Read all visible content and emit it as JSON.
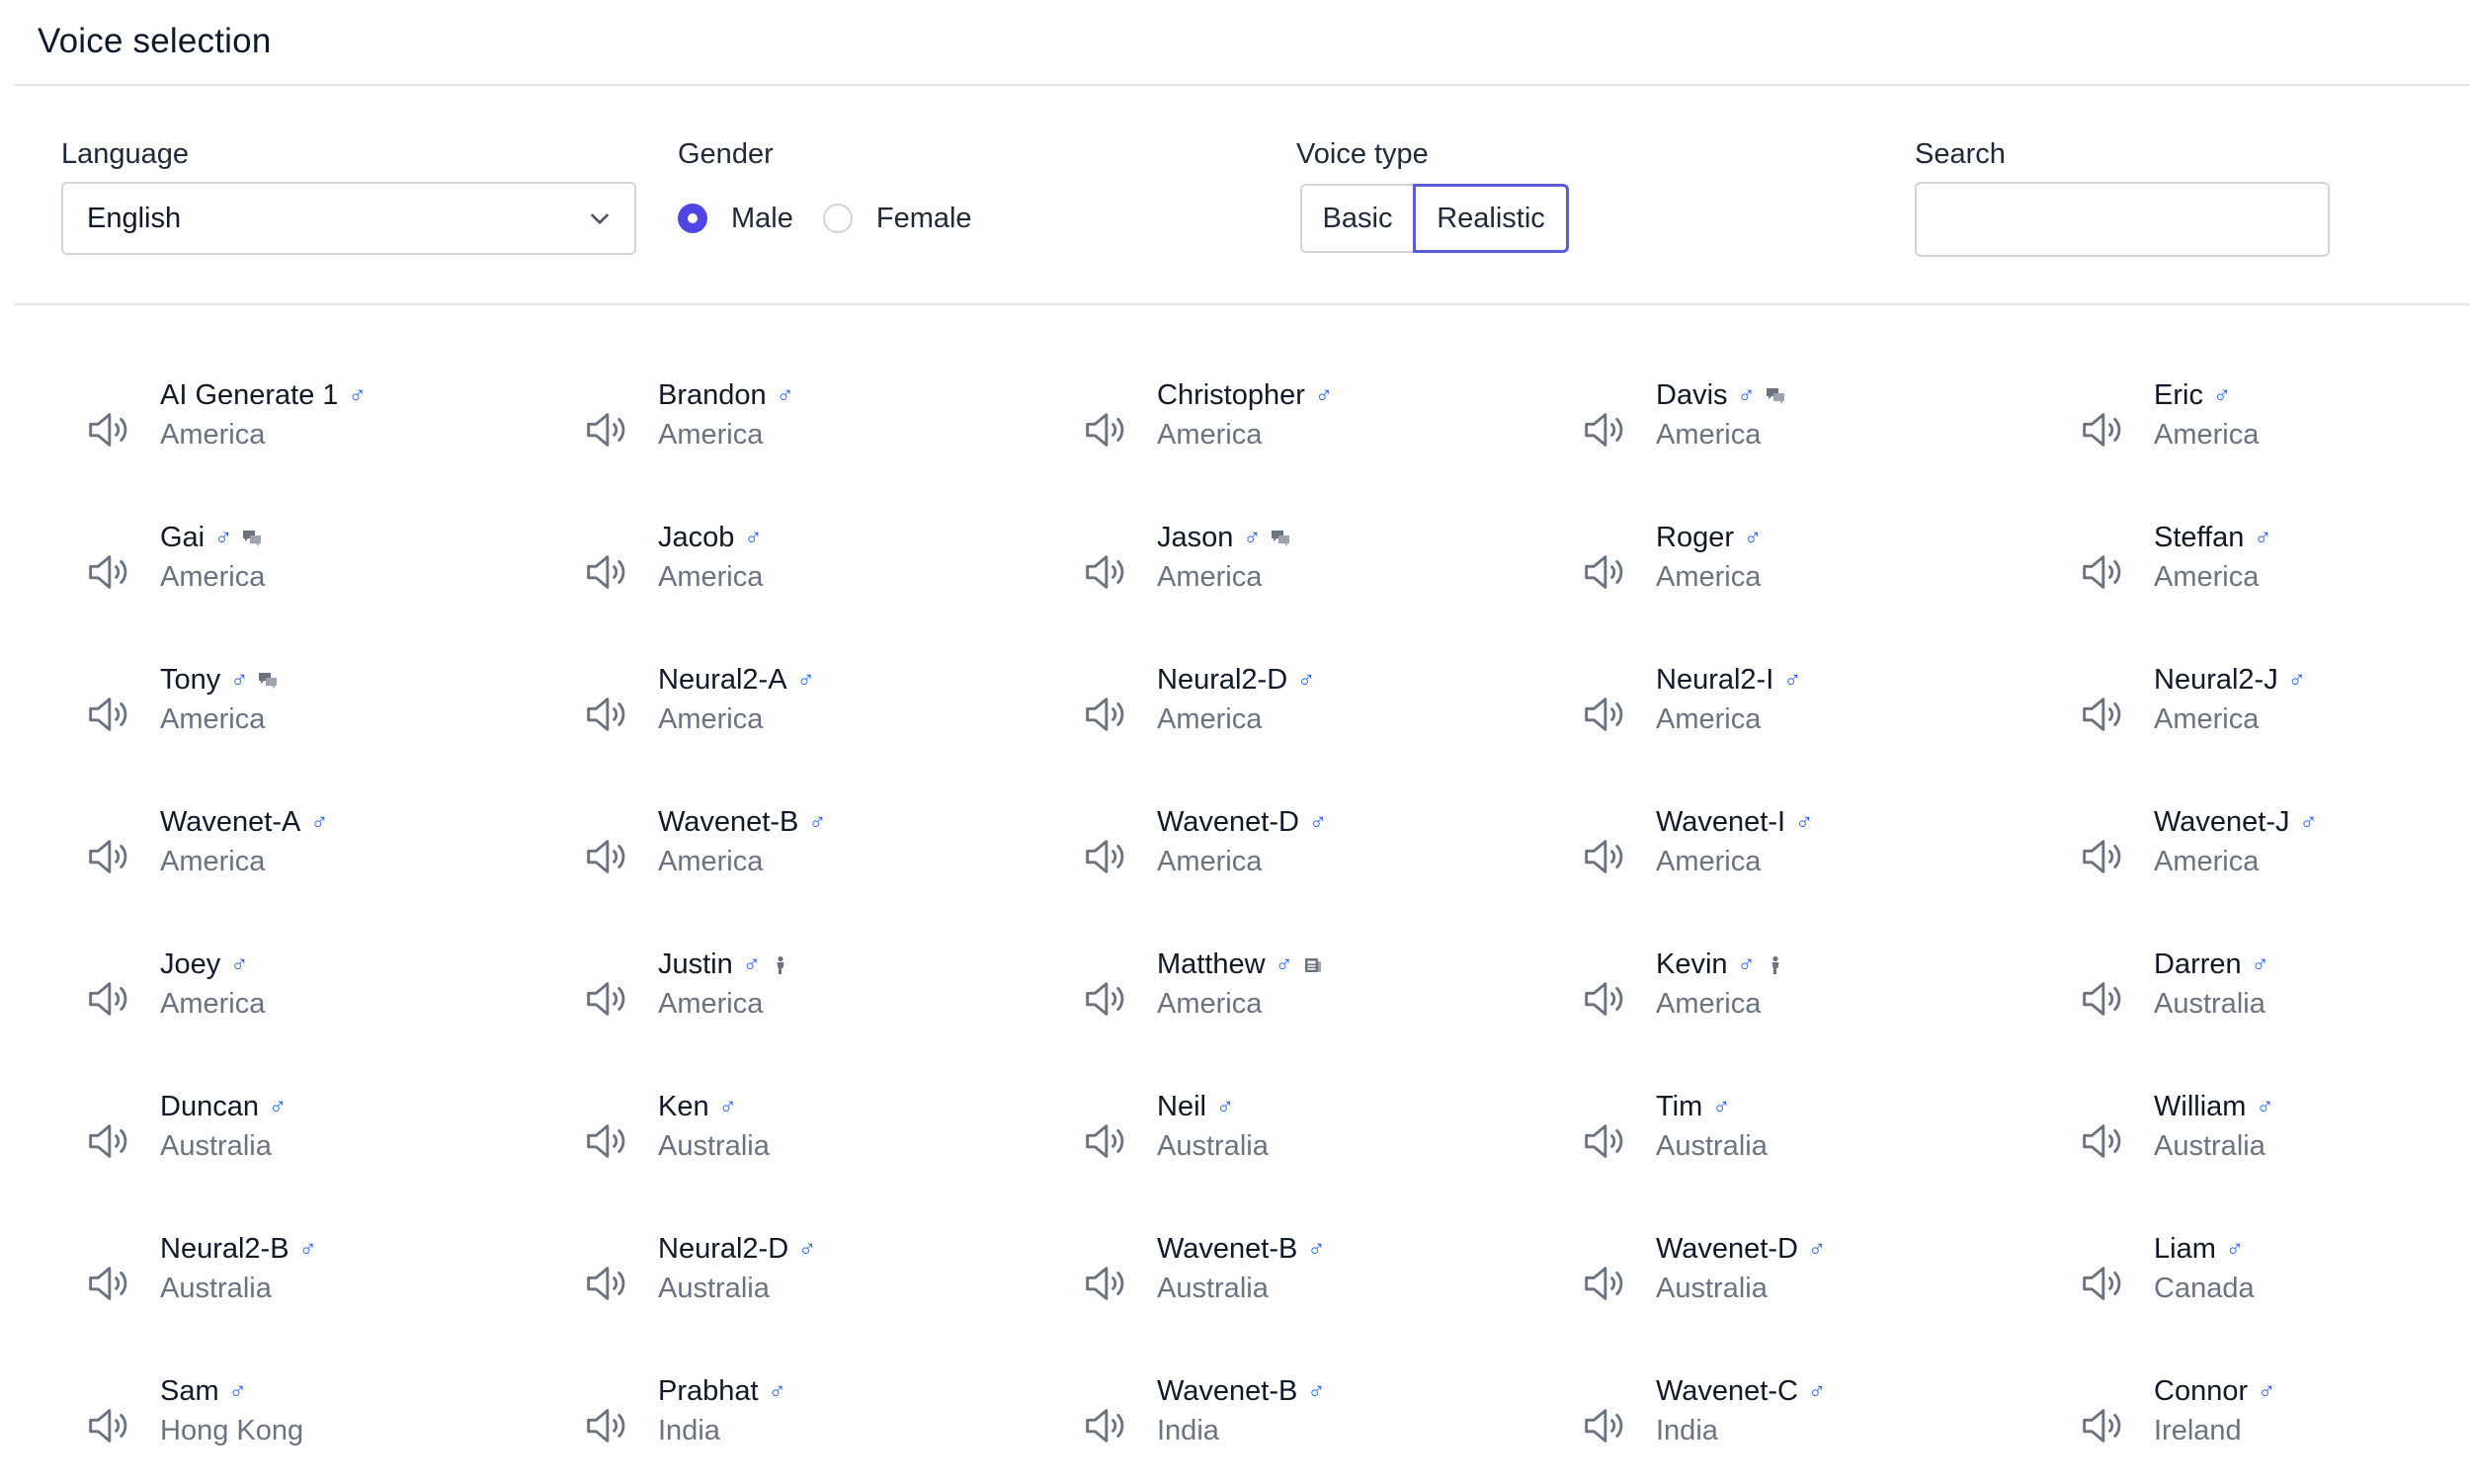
{
  "header": {
    "title": "Voice selection"
  },
  "filters": {
    "language": {
      "label": "Language",
      "value": "English"
    },
    "gender": {
      "label": "Gender",
      "options": [
        {
          "label": "Male",
          "checked": true
        },
        {
          "label": "Female",
          "checked": false
        }
      ]
    },
    "voice_type": {
      "label": "Voice type",
      "options": [
        {
          "label": "Basic",
          "selected": false
        },
        {
          "label": "Realistic",
          "selected": true
        }
      ]
    },
    "search": {
      "label": "Search",
      "value": "",
      "placeholder": ""
    }
  },
  "colors": {
    "accent": "#4f46e5",
    "male_icon": "#2563eb",
    "region_text": "#6b7280",
    "divider": "#e5e7eb"
  },
  "voices": [
    {
      "name": "AI Generate 1",
      "region": "America",
      "badge": ""
    },
    {
      "name": "Brandon",
      "region": "America",
      "badge": ""
    },
    {
      "name": "Christopher",
      "region": "America",
      "badge": ""
    },
    {
      "name": "Davis",
      "region": "America",
      "badge": "chat-icon"
    },
    {
      "name": "Eric",
      "region": "America",
      "badge": ""
    },
    {
      "name": "Gai",
      "region": "America",
      "badge": "chat-icon"
    },
    {
      "name": "Jacob",
      "region": "America",
      "badge": ""
    },
    {
      "name": "Jason",
      "region": "America",
      "badge": "chat-icon"
    },
    {
      "name": "Roger",
      "region": "America",
      "badge": ""
    },
    {
      "name": "Steffan",
      "region": "America",
      "badge": ""
    },
    {
      "name": "Tony",
      "region": "America",
      "badge": "chat-icon"
    },
    {
      "name": "Neural2-A",
      "region": "America",
      "badge": ""
    },
    {
      "name": "Neural2-D",
      "region": "America",
      "badge": ""
    },
    {
      "name": "Neural2-I",
      "region": "America",
      "badge": ""
    },
    {
      "name": "Neural2-J",
      "region": "America",
      "badge": ""
    },
    {
      "name": "Wavenet-A",
      "region": "America",
      "badge": ""
    },
    {
      "name": "Wavenet-B",
      "region": "America",
      "badge": ""
    },
    {
      "name": "Wavenet-D",
      "region": "America",
      "badge": ""
    },
    {
      "name": "Wavenet-I",
      "region": "America",
      "badge": ""
    },
    {
      "name": "Wavenet-J",
      "region": "America",
      "badge": ""
    },
    {
      "name": "Joey",
      "region": "America",
      "badge": ""
    },
    {
      "name": "Justin",
      "region": "America",
      "badge": "child-icon"
    },
    {
      "name": "Matthew",
      "region": "America",
      "badge": "news-icon"
    },
    {
      "name": "Kevin",
      "region": "America",
      "badge": "child-icon"
    },
    {
      "name": "Darren",
      "region": "Australia",
      "badge": ""
    },
    {
      "name": "Duncan",
      "region": "Australia",
      "badge": ""
    },
    {
      "name": "Ken",
      "region": "Australia",
      "badge": ""
    },
    {
      "name": "Neil",
      "region": "Australia",
      "badge": ""
    },
    {
      "name": "Tim",
      "region": "Australia",
      "badge": ""
    },
    {
      "name": "William",
      "region": "Australia",
      "badge": ""
    },
    {
      "name": "Neural2-B",
      "region": "Australia",
      "badge": ""
    },
    {
      "name": "Neural2-D",
      "region": "Australia",
      "badge": ""
    },
    {
      "name": "Wavenet-B",
      "region": "Australia",
      "badge": ""
    },
    {
      "name": "Wavenet-D",
      "region": "Australia",
      "badge": ""
    },
    {
      "name": "Liam",
      "region": "Canada",
      "badge": ""
    },
    {
      "name": "Sam",
      "region": "Hong Kong",
      "badge": ""
    },
    {
      "name": "Prabhat",
      "region": "India",
      "badge": ""
    },
    {
      "name": "Wavenet-B",
      "region": "India",
      "badge": ""
    },
    {
      "name": "Wavenet-C",
      "region": "India",
      "badge": ""
    },
    {
      "name": "Connor",
      "region": "Ireland",
      "badge": ""
    }
  ]
}
